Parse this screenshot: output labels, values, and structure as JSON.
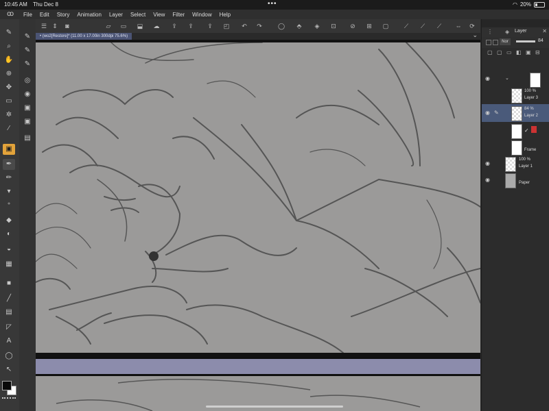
{
  "status": {
    "time": "10:45 AM",
    "date": "Thu Dec 8",
    "battery": "20%"
  },
  "menu": [
    "File",
    "Edit",
    "Story",
    "Animation",
    "Layer",
    "Select",
    "View",
    "Filter",
    "Window",
    "Help"
  ],
  "document": {
    "tab_label": "• (wo2[Restore]* (11.00 x 17.00in 300dpi 75.6%)"
  },
  "layer_panel": {
    "title": "Layer",
    "blend_mode": "Nor",
    "opacity": "84",
    "layers": [
      {
        "percent": "100 %",
        "name": "Layer 3"
      },
      {
        "percent": "84 %",
        "name": "Layer 2"
      },
      {
        "percent": "",
        "name": ""
      },
      {
        "percent": "",
        "name": "Frame"
      },
      {
        "percent": "100 %",
        "name": "Layer 1"
      },
      {
        "percent": "",
        "name": "Paper"
      }
    ]
  },
  "accent": {
    "selection": "#4a5a7a",
    "tool_active": "#e3a33a",
    "divider": "#8c8cac"
  }
}
